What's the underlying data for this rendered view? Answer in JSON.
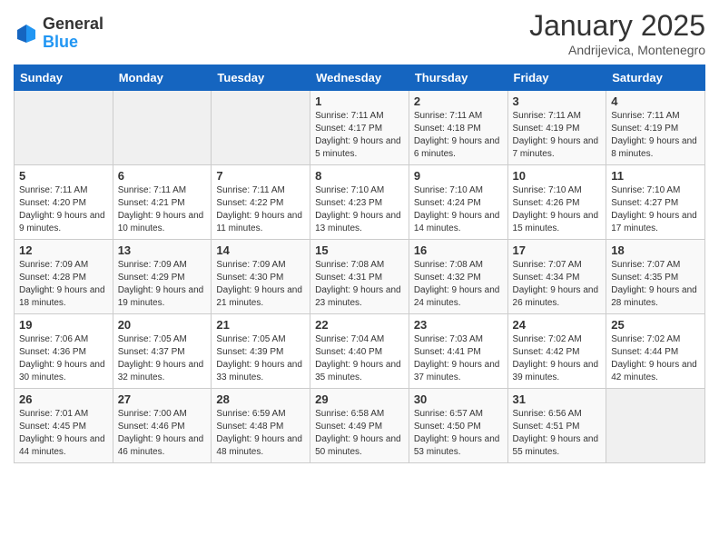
{
  "header": {
    "logo_general": "General",
    "logo_blue": "Blue",
    "title": "January 2025",
    "subtitle": "Andrijevica, Montenegro"
  },
  "days_of_week": [
    "Sunday",
    "Monday",
    "Tuesday",
    "Wednesday",
    "Thursday",
    "Friday",
    "Saturday"
  ],
  "weeks": [
    [
      {
        "day": "",
        "info": ""
      },
      {
        "day": "",
        "info": ""
      },
      {
        "day": "",
        "info": ""
      },
      {
        "day": "1",
        "info": "Sunrise: 7:11 AM\nSunset: 4:17 PM\nDaylight: 9 hours and 5 minutes."
      },
      {
        "day": "2",
        "info": "Sunrise: 7:11 AM\nSunset: 4:18 PM\nDaylight: 9 hours and 6 minutes."
      },
      {
        "day": "3",
        "info": "Sunrise: 7:11 AM\nSunset: 4:19 PM\nDaylight: 9 hours and 7 minutes."
      },
      {
        "day": "4",
        "info": "Sunrise: 7:11 AM\nSunset: 4:19 PM\nDaylight: 9 hours and 8 minutes."
      }
    ],
    [
      {
        "day": "5",
        "info": "Sunrise: 7:11 AM\nSunset: 4:20 PM\nDaylight: 9 hours and 9 minutes."
      },
      {
        "day": "6",
        "info": "Sunrise: 7:11 AM\nSunset: 4:21 PM\nDaylight: 9 hours and 10 minutes."
      },
      {
        "day": "7",
        "info": "Sunrise: 7:11 AM\nSunset: 4:22 PM\nDaylight: 9 hours and 11 minutes."
      },
      {
        "day": "8",
        "info": "Sunrise: 7:10 AM\nSunset: 4:23 PM\nDaylight: 9 hours and 13 minutes."
      },
      {
        "day": "9",
        "info": "Sunrise: 7:10 AM\nSunset: 4:24 PM\nDaylight: 9 hours and 14 minutes."
      },
      {
        "day": "10",
        "info": "Sunrise: 7:10 AM\nSunset: 4:26 PM\nDaylight: 9 hours and 15 minutes."
      },
      {
        "day": "11",
        "info": "Sunrise: 7:10 AM\nSunset: 4:27 PM\nDaylight: 9 hours and 17 minutes."
      }
    ],
    [
      {
        "day": "12",
        "info": "Sunrise: 7:09 AM\nSunset: 4:28 PM\nDaylight: 9 hours and 18 minutes."
      },
      {
        "day": "13",
        "info": "Sunrise: 7:09 AM\nSunset: 4:29 PM\nDaylight: 9 hours and 19 minutes."
      },
      {
        "day": "14",
        "info": "Sunrise: 7:09 AM\nSunset: 4:30 PM\nDaylight: 9 hours and 21 minutes."
      },
      {
        "day": "15",
        "info": "Sunrise: 7:08 AM\nSunset: 4:31 PM\nDaylight: 9 hours and 23 minutes."
      },
      {
        "day": "16",
        "info": "Sunrise: 7:08 AM\nSunset: 4:32 PM\nDaylight: 9 hours and 24 minutes."
      },
      {
        "day": "17",
        "info": "Sunrise: 7:07 AM\nSunset: 4:34 PM\nDaylight: 9 hours and 26 minutes."
      },
      {
        "day": "18",
        "info": "Sunrise: 7:07 AM\nSunset: 4:35 PM\nDaylight: 9 hours and 28 minutes."
      }
    ],
    [
      {
        "day": "19",
        "info": "Sunrise: 7:06 AM\nSunset: 4:36 PM\nDaylight: 9 hours and 30 minutes."
      },
      {
        "day": "20",
        "info": "Sunrise: 7:05 AM\nSunset: 4:37 PM\nDaylight: 9 hours and 32 minutes."
      },
      {
        "day": "21",
        "info": "Sunrise: 7:05 AM\nSunset: 4:39 PM\nDaylight: 9 hours and 33 minutes."
      },
      {
        "day": "22",
        "info": "Sunrise: 7:04 AM\nSunset: 4:40 PM\nDaylight: 9 hours and 35 minutes."
      },
      {
        "day": "23",
        "info": "Sunrise: 7:03 AM\nSunset: 4:41 PM\nDaylight: 9 hours and 37 minutes."
      },
      {
        "day": "24",
        "info": "Sunrise: 7:02 AM\nSunset: 4:42 PM\nDaylight: 9 hours and 39 minutes."
      },
      {
        "day": "25",
        "info": "Sunrise: 7:02 AM\nSunset: 4:44 PM\nDaylight: 9 hours and 42 minutes."
      }
    ],
    [
      {
        "day": "26",
        "info": "Sunrise: 7:01 AM\nSunset: 4:45 PM\nDaylight: 9 hours and 44 minutes."
      },
      {
        "day": "27",
        "info": "Sunrise: 7:00 AM\nSunset: 4:46 PM\nDaylight: 9 hours and 46 minutes."
      },
      {
        "day": "28",
        "info": "Sunrise: 6:59 AM\nSunset: 4:48 PM\nDaylight: 9 hours and 48 minutes."
      },
      {
        "day": "29",
        "info": "Sunrise: 6:58 AM\nSunset: 4:49 PM\nDaylight: 9 hours and 50 minutes."
      },
      {
        "day": "30",
        "info": "Sunrise: 6:57 AM\nSunset: 4:50 PM\nDaylight: 9 hours and 53 minutes."
      },
      {
        "day": "31",
        "info": "Sunrise: 6:56 AM\nSunset: 4:51 PM\nDaylight: 9 hours and 55 minutes."
      },
      {
        "day": "",
        "info": ""
      }
    ]
  ]
}
